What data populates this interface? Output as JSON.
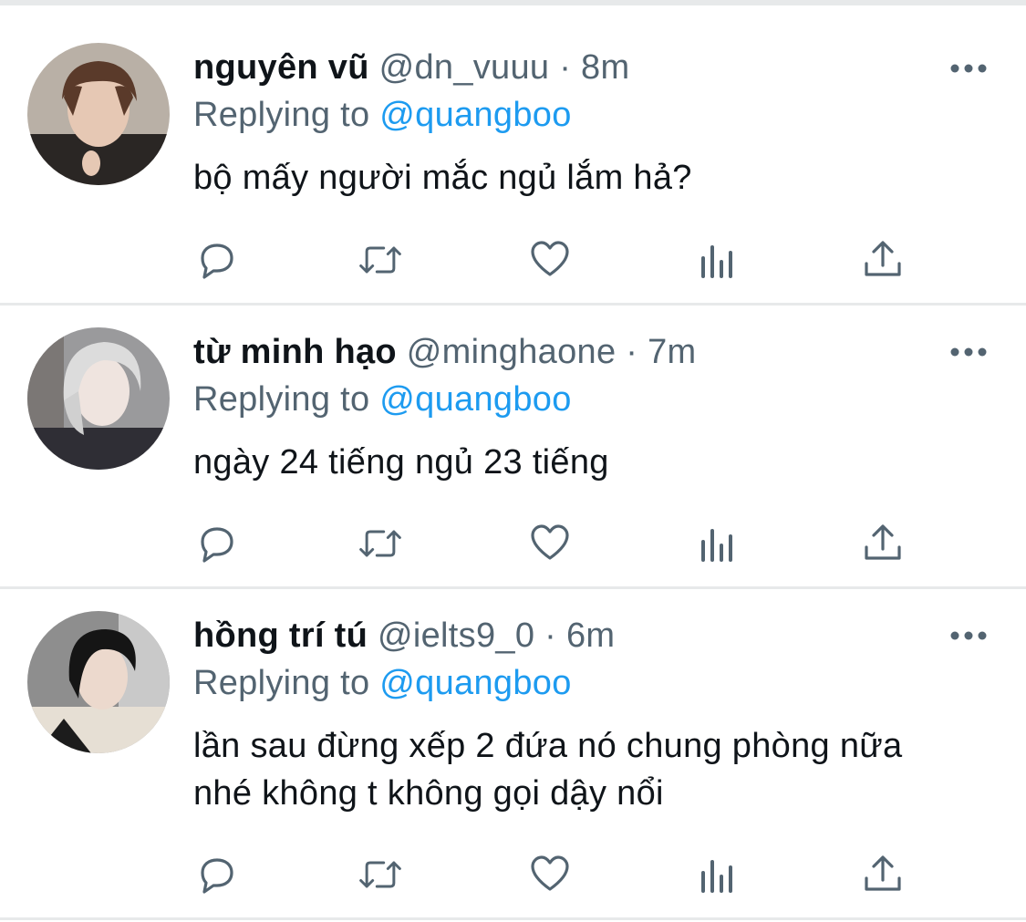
{
  "tweets": [
    {
      "name": "nguyên vũ",
      "handle": "@dn_vuuu",
      "separator": "·",
      "time": "8m",
      "replying_prefix": "Replying to",
      "replying_to": "@quangboo",
      "text": "bộ mấy người mắc ngủ lắm hả?"
    },
    {
      "name": "từ minh hạo",
      "handle": "@minghaone",
      "separator": "·",
      "time": "7m",
      "replying_prefix": "Replying to",
      "replying_to": "@quangboo",
      "text": "ngày 24 tiếng ngủ 23 tiếng"
    },
    {
      "name": "hồng trí tú",
      "handle": "@ielts9_0",
      "separator": "·",
      "time": "6m",
      "replying_prefix": "Replying to",
      "replying_to": "@quangboo",
      "text": "lần sau đừng xếp 2 đứa nó chung phòng nữa nhé không t không gọi dậy nổi"
    }
  ],
  "icons": {
    "more": "more-horizontal-icon",
    "reply": "reply-bubble-icon",
    "retweet": "retweet-icon",
    "like": "heart-icon",
    "views": "analytics-bars-icon",
    "share": "share-upload-icon"
  },
  "colors": {
    "name": "#0f1419",
    "secondary": "#536471",
    "mention": "#1d9bf0",
    "divider": "#e7e9ea"
  }
}
